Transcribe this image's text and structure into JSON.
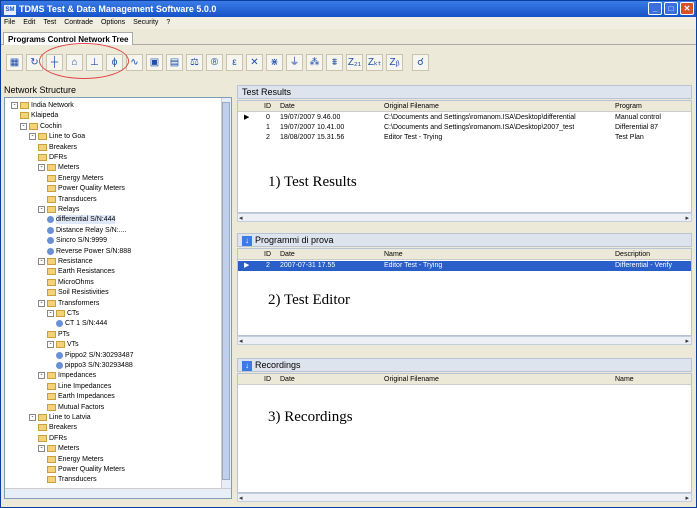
{
  "window": {
    "title": "TDMS Test & Data Management Software 5.0.0",
    "app_icon": "SM"
  },
  "menu": [
    "File",
    "Edit",
    "Test",
    "Contrade",
    "Options",
    "Security",
    "?"
  ],
  "tab": {
    "label": "Programs Control  Network Tree"
  },
  "toolbar": {
    "icons": [
      "grid-icon",
      "refresh-icon",
      "circuit-breaker-icon",
      "meter-icon",
      "ground-icon",
      "voltage-icon",
      "wave-icon",
      "screen-icon",
      "window-icon",
      "scale-icon",
      "resistance-icon",
      "transformer-icon",
      "cross-icon",
      "coil-icon",
      "ground-bar-icon",
      "impedance-icon",
      "impedance2-icon",
      "z21-icon",
      "zkt-icon",
      "zb-icon",
      "binoculars-icon"
    ],
    "glyphs": [
      "▦",
      "↻",
      "┼",
      "⌂",
      "⊥",
      "ϕ",
      "∿",
      "▣",
      "▤",
      "⚖",
      "®",
      "ε",
      "✕",
      "⋇",
      "⏚",
      "⁂",
      "⩩",
      "Z₂₁",
      "Zₖₜ",
      "Zᵦ",
      "☌"
    ]
  },
  "network_structure": {
    "label": "Network Structure",
    "nodes": [
      {
        "text": "India Network",
        "level": 0,
        "exp": "-"
      },
      {
        "text": "Klaipeda",
        "level": 1,
        "exp": ""
      },
      {
        "text": "Cochin",
        "level": 1,
        "exp": "-"
      },
      {
        "text": "Line to Goa",
        "level": 2,
        "exp": "-"
      },
      {
        "text": "Breakers",
        "level": 3,
        "exp": ""
      },
      {
        "text": "DFRs",
        "level": 3,
        "exp": ""
      },
      {
        "text": "Meters",
        "level": 3,
        "exp": "-"
      },
      {
        "text": "Energy Meters",
        "level": 4,
        "exp": ""
      },
      {
        "text": "Power Quality Meters",
        "level": 4,
        "exp": ""
      },
      {
        "text": "Transducers",
        "level": 4,
        "exp": ""
      },
      {
        "text": "Relays",
        "level": 3,
        "exp": "-"
      },
      {
        "text": "differential S/N:444",
        "level": 4,
        "exp": "",
        "dev": true,
        "sel": true
      },
      {
        "text": "Distance Relay S/N:....",
        "level": 4,
        "exp": "",
        "dev": true
      },
      {
        "text": "Sincro S/N:9999",
        "level": 4,
        "exp": "",
        "dev": true
      },
      {
        "text": "Reverse Power S/N:888",
        "level": 4,
        "exp": "",
        "dev": true
      },
      {
        "text": "Resistance",
        "level": 3,
        "exp": "-"
      },
      {
        "text": "Earth Resistances",
        "level": 4,
        "exp": ""
      },
      {
        "text": "MicroOhms",
        "level": 4,
        "exp": ""
      },
      {
        "text": "Soil Resistivities",
        "level": 4,
        "exp": ""
      },
      {
        "text": "Transformers",
        "level": 3,
        "exp": "-"
      },
      {
        "text": "CTs",
        "level": 4,
        "exp": "-"
      },
      {
        "text": "CT 1 S/N:444",
        "level": 5,
        "exp": "",
        "dev": true
      },
      {
        "text": "PTs",
        "level": 4,
        "exp": ""
      },
      {
        "text": "VTs",
        "level": 4,
        "exp": "-"
      },
      {
        "text": "Pippo2 S/N:30293487",
        "level": 5,
        "exp": "",
        "dev": true
      },
      {
        "text": "pippo3 S/N:30293488",
        "level": 5,
        "exp": "",
        "dev": true
      },
      {
        "text": "Impedances",
        "level": 3,
        "exp": "-"
      },
      {
        "text": "Line Impedances",
        "level": 4,
        "exp": ""
      },
      {
        "text": "Earth Impedances",
        "level": 4,
        "exp": ""
      },
      {
        "text": "Mutual Factors",
        "level": 4,
        "exp": ""
      },
      {
        "text": "Line to Latvia",
        "level": 2,
        "exp": "-"
      },
      {
        "text": "Breakers",
        "level": 3,
        "exp": ""
      },
      {
        "text": "DFRs",
        "level": 3,
        "exp": ""
      },
      {
        "text": "Meters",
        "level": 3,
        "exp": "-"
      },
      {
        "text": "Energy Meters",
        "level": 4,
        "exp": ""
      },
      {
        "text": "Power Quality Meters",
        "level": 4,
        "exp": ""
      },
      {
        "text": "Transducers",
        "level": 4,
        "exp": ""
      }
    ]
  },
  "test_results": {
    "title": "Test Results",
    "columns": [
      "ID",
      "Date",
      "Original Filename",
      "Program"
    ],
    "rows": [
      {
        "marker": "▶",
        "id": "0",
        "date": "19/07/2007 9.46.00",
        "file": "C:\\Documents and Settings\\romanom.ISA\\Desktop\\differential",
        "program": "Manual control"
      },
      {
        "marker": "",
        "id": "1",
        "date": "19/07/2007 10.41.00",
        "file": "C:\\Documents and Settings\\romanom.ISA\\Desktop\\2007_test",
        "program": "Differential 87"
      },
      {
        "marker": "",
        "id": "2",
        "date": "18/08/2007 15.31.56",
        "file": "Editor Test - Trying",
        "program": "Test Plan"
      }
    ],
    "annotation": "1) Test Results"
  },
  "test_editor": {
    "title": "Programmi di prova",
    "columns": [
      "ID",
      "Date",
      "Name",
      "Description"
    ],
    "rows": [
      {
        "marker": "▶",
        "id": "2",
        "date": "2007-07-31 17.55",
        "name": "Editor Test - Trying",
        "desc": "Differential - Verify"
      }
    ],
    "annotation": "2) Test Editor"
  },
  "recordings": {
    "title": "Recordings",
    "columns": [
      "ID",
      "Date",
      "Original Filename",
      "Name"
    ],
    "annotation": "3) Recordings"
  },
  "scroll": {
    "left": "◂",
    "right": "▸",
    "down": "▾"
  }
}
